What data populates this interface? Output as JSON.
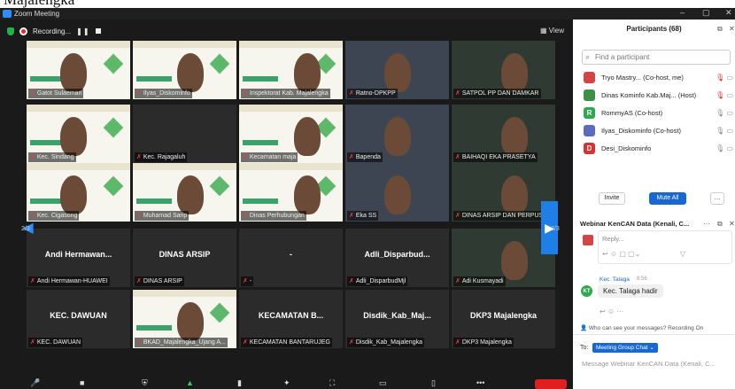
{
  "top_strip": {
    "text": "Majalengka"
  },
  "window": {
    "title": "Zoom Meeting",
    "min": "–",
    "max": "▢",
    "close": "✕"
  },
  "meeting": {
    "recording_label": "Recording...",
    "pause_symbol": "❚❚",
    "view_label": "View",
    "page_left": "2/3",
    "page_right": "2/3",
    "tiles": [
      {
        "label": "Gatot Sulaeman",
        "video": true
      },
      {
        "label": "Ilyas_Diskominfo",
        "video": true
      },
      {
        "label": "Inspektorat Kab. Majalengka",
        "video": true
      },
      {
        "label": "Ratno-DPKPP",
        "video": true
      },
      {
        "label": "SATPOL PP DAN DAMKAR",
        "video": true
      },
      {
        "label": "Kec. Sindang",
        "video": true
      },
      {
        "label": "Kec. Rajagaluh",
        "video": false
      },
      {
        "label": "Kecamatan maja",
        "video": true
      },
      {
        "label": "Bapenda",
        "video": true
      },
      {
        "label": "BAIHAQI EKA PRASETYA",
        "video": true
      },
      {
        "label": "Kec. Cigasong",
        "video": true
      },
      {
        "label": "Muhamad Sarip",
        "video": true
      },
      {
        "label": "Dinas Perhubungan",
        "video": true
      },
      {
        "label": "Eka SS",
        "video": true
      },
      {
        "label": "DINAS ARSIP DAN PERPUS",
        "video": true
      },
      {
        "label": "Andi Hermawan-HUAWEI",
        "name": "Andi Hermawan...",
        "video": false
      },
      {
        "label": "DINAS ARSIP",
        "name": "DINAS ARSIP",
        "video": false
      },
      {
        "label": "-",
        "name": "-",
        "video": false
      },
      {
        "label": "Adli_DisparbudMjl",
        "name": "Adli_Disparbud...",
        "video": false
      },
      {
        "label": "Adi Kusmayadi",
        "video": true
      },
      {
        "label": "KEC. DAWUAN",
        "name": "KEC. DAWUAN",
        "video": false
      },
      {
        "label": "BKAD_Majalengka_Ujang A...",
        "video": true
      },
      {
        "label": "KECAMATAN BANTARUJEG",
        "name": "KECAMATAN B...",
        "video": false
      },
      {
        "label": "Disdik_Kab_Majalengka",
        "name": "Disdik_Kab_Maj...",
        "video": false
      },
      {
        "label": "DKP3 Majalengka",
        "name": "DKP3 Majalengka",
        "video": false
      }
    ]
  },
  "participants": {
    "title": "Participants (68)",
    "search_placeholder": "Find a participant",
    "list": [
      {
        "initial": "",
        "name": "Tryo Mastry... (Co-host, me)",
        "color": "#d64545"
      },
      {
        "initial": "",
        "name": "Dinas Kominfo Kab.Maj... (Host)",
        "color": "#3b8f47"
      },
      {
        "initial": "R",
        "name": "RommyAS (Co-host)",
        "color": "#2fa84f"
      },
      {
        "initial": "",
        "name": "Ilyas_Diskominfo (Co-host)",
        "color": "#5b6cc0"
      },
      {
        "initial": "D",
        "name": "Desi_Diskominfo",
        "color": "#d93030"
      }
    ],
    "invite": "Invite",
    "mute_all": "Mute All",
    "more": "…"
  },
  "chat": {
    "title": "Webinar KenCAN Data (Kenali, C...",
    "reply": "Reply...",
    "sender": "Kec. Talaga",
    "time": "8:56",
    "avatar": "KT",
    "message": "Kec. Talaga hadir",
    "who_can_see": "Who can see your messages? Recording On",
    "to_label": "To:",
    "to_target": "Meeting Group Chat ⌄",
    "input_placeholder": "Message Webinar KenCAN Data (Kenali, C..."
  }
}
